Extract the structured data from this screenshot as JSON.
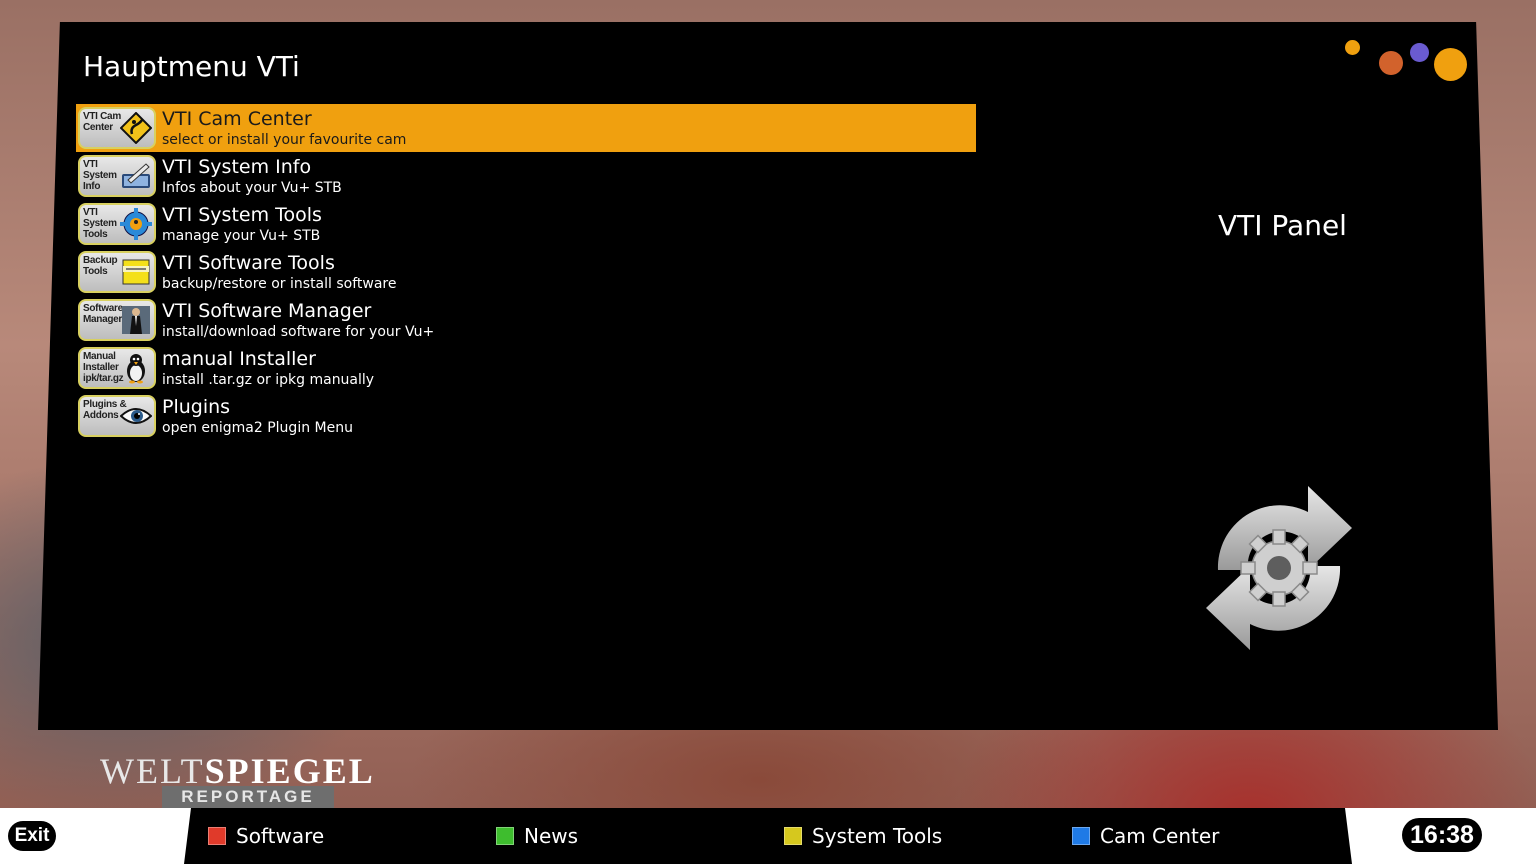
{
  "window": {
    "title": "Hauptmenu VTi"
  },
  "accent_colors": {
    "selection": "#f0a00f",
    "dot_small": "#f0a00f",
    "dot_orange": "#d2622c",
    "dot_purple": "#6a5bd0",
    "dot_large": "#f0a00f"
  },
  "menu": {
    "items": [
      {
        "title": "VTI Cam Center",
        "description": "select or install your favourite cam",
        "icon_label": "VTI Cam Center",
        "icon": "road-sign-icon",
        "selected": true
      },
      {
        "title": "VTI System Info",
        "description": "Infos about your Vu+ STB",
        "icon_label": "VTI System Info",
        "icon": "info-pen-icon",
        "selected": false
      },
      {
        "title": "VTI System Tools",
        "description": "manage your Vu+ STB",
        "icon_label": "VTI System Tools",
        "icon": "gear-icon",
        "selected": false
      },
      {
        "title": "VTI Software Tools",
        "description": "backup/restore or install software",
        "icon_label": "Backup Tools",
        "icon": "backup-icon",
        "selected": false
      },
      {
        "title": "VTI Software Manager",
        "description": "install/download software for your Vu+",
        "icon_label": "Software Manager",
        "icon": "manager-icon",
        "selected": false
      },
      {
        "title": "manual Installer",
        "description": "install .tar.gz or ipkg manually",
        "icon_label": "Manual Installer ipk/tar.gz",
        "icon": "penguin-icon",
        "selected": false
      },
      {
        "title": "Plugins",
        "description": "open enigma2 Plugin Menu",
        "icon_label": "Plugins & Addons",
        "icon": "eye-icon",
        "selected": false
      }
    ]
  },
  "panel": {
    "title": "VTI Panel",
    "icon": "gear-refresh-icon"
  },
  "channel_logo": {
    "main_part1": "WELT",
    "main_part2": "SPIEGEL",
    "sub": "REPORTAGE"
  },
  "bottom_bar": {
    "exit_label": "Exit",
    "keys": [
      {
        "label": "Software",
        "color": "#e03a2a",
        "name": "red"
      },
      {
        "label": "News",
        "color": "#3ebd2e",
        "name": "green"
      },
      {
        "label": "System Tools",
        "color": "#d6c81e",
        "name": "yellow"
      },
      {
        "label": "Cam Center",
        "color": "#1f7ae6",
        "name": "blue"
      }
    ],
    "clock": "16:38"
  }
}
